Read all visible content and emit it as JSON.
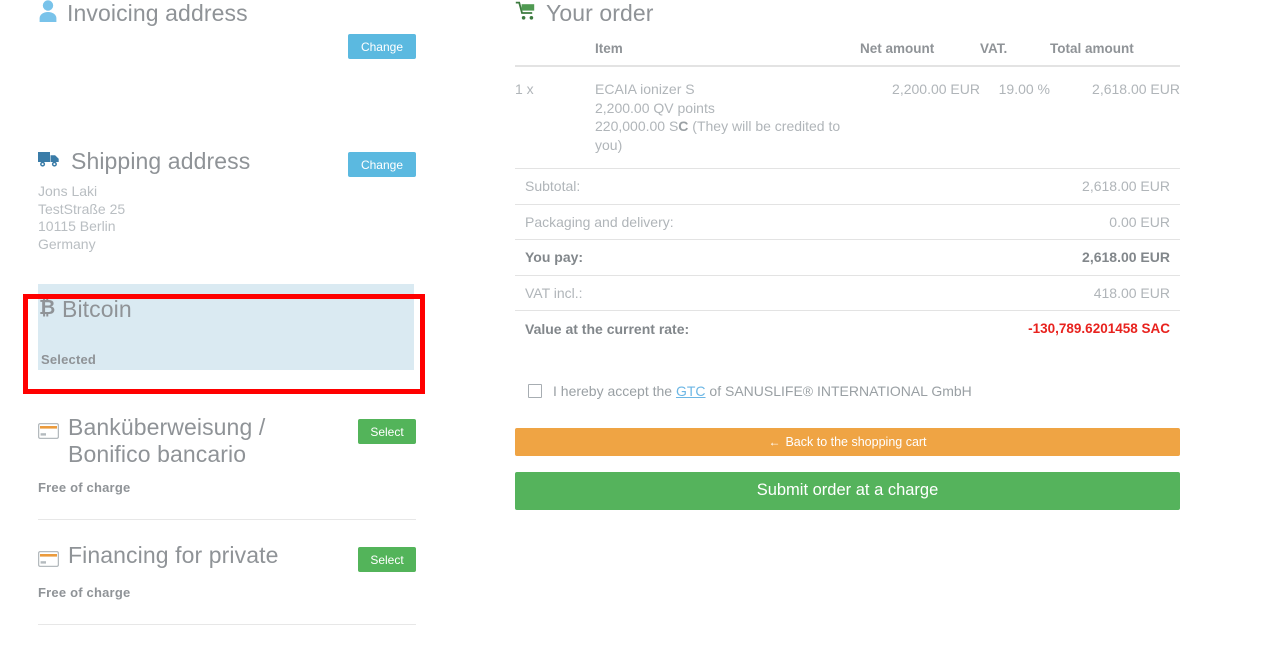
{
  "invoicing": {
    "title": "Invoicing address",
    "icon": "user-icon",
    "change_label": "Change"
  },
  "shipping": {
    "title": "Shipping address",
    "icon": "truck-icon",
    "change_label": "Change",
    "address": [
      "Jons Laki",
      "TestStraße 25",
      "10115 Berlin",
      "Germany"
    ]
  },
  "payment_methods": [
    {
      "id": "bitcoin",
      "title": "Bitcoin",
      "icon": "bitcoin-icon",
      "state_label": "Selected",
      "selected": true,
      "highlighted": true
    },
    {
      "id": "bank-transfer",
      "title": "Banküberweisung / Bonifico bancario",
      "icon": "credit-card-icon",
      "action_label": "Select",
      "note": "Free of charge",
      "selected": false
    },
    {
      "id": "financing-private",
      "title": "Financing for private",
      "icon": "credit-card-icon",
      "action_label": "Select",
      "note": "Free of charge",
      "selected": false
    }
  ],
  "order": {
    "title": "Your order",
    "icon": "shopping-cart-icon",
    "columns": {
      "qty": "",
      "item": "Item",
      "net": "Net amount",
      "vat": "VAT.",
      "total": "Total amount"
    },
    "rows": [
      {
        "qty": "1 x",
        "item_name": "ECAIA ionizer S",
        "item_line2": "2,200.00 QV points",
        "item_line3_pre": "220,000.00 S",
        "item_line3_sym": "C",
        "item_line3_post": " (They will be credited to you)",
        "net": "2,200.00 EUR",
        "vat": "19.00 %",
        "total": "2,618.00 EUR"
      }
    ],
    "totals": [
      {
        "label": "Subtotal:",
        "value": "2,618.00 EUR",
        "bold": false
      },
      {
        "label": "Packaging and delivery:",
        "value": "0.00 EUR",
        "bold": false
      },
      {
        "label": "You pay:",
        "value": "2,618.00 EUR",
        "bold": true
      },
      {
        "label": "VAT incl.:",
        "value": "418.00 EUR",
        "bold": false
      }
    ],
    "rate": {
      "label": "Value at the current rate:",
      "value": "-130,789.6201458 SAC",
      "color": "#e8221e"
    }
  },
  "terms": {
    "text_before": "I hereby accept the ",
    "link": "GTC",
    "text_after": " of SANUSLIFE® INTERNATIONAL GmbH",
    "checked": false
  },
  "actions": {
    "back_label": "Back to the shopping cart",
    "back_arrow": "←",
    "submit_label": "Submit order at a charge"
  },
  "colors": {
    "accent_blue": "#5bb9e0",
    "accent_green": "#53b45a",
    "accent_orange": "#efa444",
    "selected_bg": "#daeaf2",
    "highlight_red": "#ff0000",
    "alert_red": "#e8221e"
  }
}
